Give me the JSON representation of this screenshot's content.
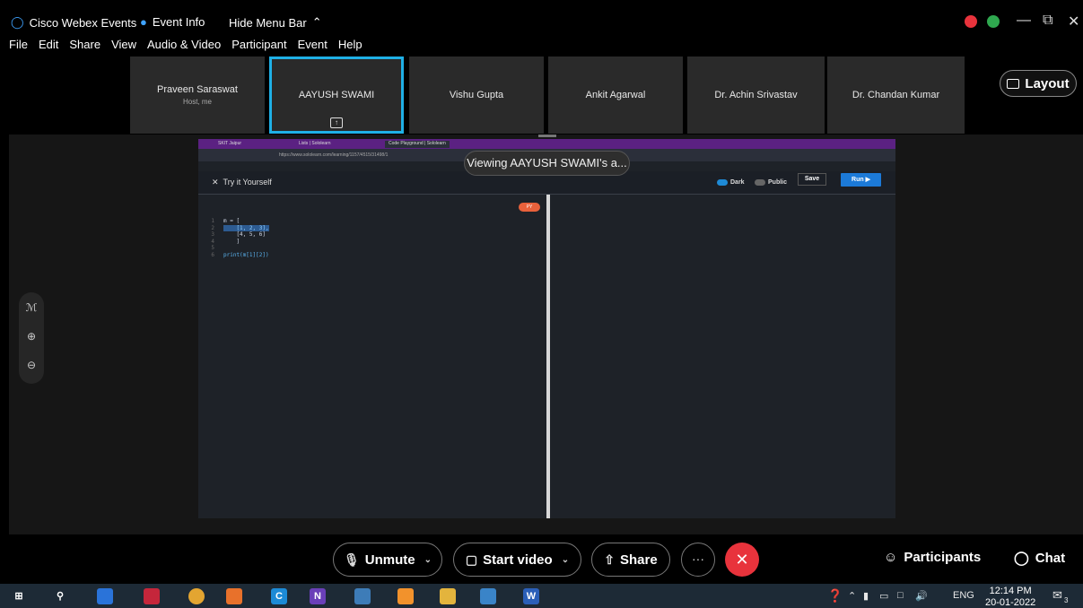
{
  "titlebar": {
    "app_name": "Cisco Webex Events",
    "event_info": "Event Info",
    "hide_menu": "Hide Menu Bar",
    "minimize": "—",
    "restore": "⧉",
    "close": "✕"
  },
  "menu": [
    "File",
    "Edit",
    "Share",
    "View",
    "Audio & Video",
    "Participant",
    "Event",
    "Help"
  ],
  "participants": [
    {
      "name": "Praveen Saraswat",
      "sub": "Host, me"
    },
    {
      "name": "AAYUSH SWAMI",
      "sub": ""
    },
    {
      "name": "Vishu Gupta",
      "sub": ""
    },
    {
      "name": "Ankit Agarwal",
      "sub": ""
    },
    {
      "name": "Dr. Achin Srivastav",
      "sub": ""
    },
    {
      "name": "Dr. Chandan Kumar",
      "sub": ""
    }
  ],
  "layout_label": "Layout",
  "viewing_toast": "Viewing AAYUSH SWAMI's a...",
  "shared": {
    "tabs": [
      "SKIT Jaipur",
      "Lists | Sololearn",
      "Code Playground | Sololearn"
    ],
    "url": "https://www.sololearn.com/learning/1157/4515/31498/1",
    "toolbar_title": "Try it Yourself",
    "dark_label": "Dark",
    "public_label": "Public",
    "save_label": "Save",
    "run_label": "Run ▶",
    "lang_badge": "PY",
    "code_lines": [
      {
        "n": "1",
        "t": "m = ["
      },
      {
        "n": "2",
        "t": "    [1, 2, 3],"
      },
      {
        "n": "3",
        "t": "    [4, 5, 6]"
      },
      {
        "n": "4",
        "t": "    ]"
      },
      {
        "n": "5",
        "t": ""
      },
      {
        "n": "6",
        "t": "print(m[1][2])"
      }
    ]
  },
  "controls": {
    "unmute": "Unmute",
    "start_video": "Start video",
    "share": "Share",
    "more": "···",
    "end": "✕",
    "participants": "Participants",
    "chat": "Chat"
  },
  "taskbar": {
    "lang": "ENG",
    "time": "12:14 PM",
    "date": "20-01-2022",
    "notif_count": "3"
  },
  "colors": {
    "accent_blue": "#1fb0e6",
    "end_red": "#e8333c",
    "browser_purple": "#5b2182",
    "run_blue": "#1c7ad8"
  }
}
